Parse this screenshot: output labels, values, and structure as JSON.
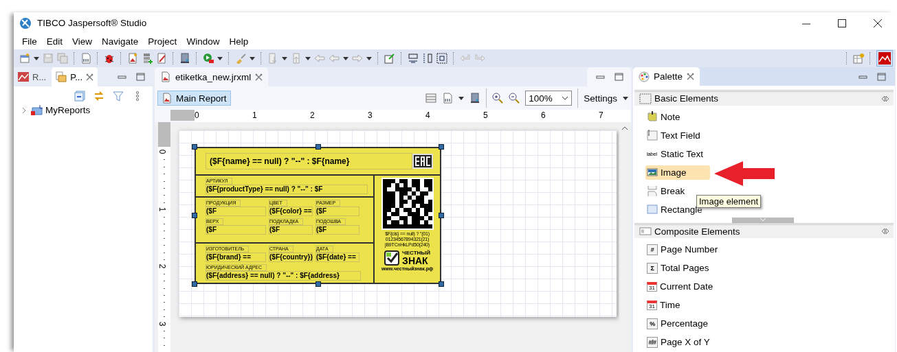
{
  "window": {
    "title": "TIBCO Jaspersoft® Studio"
  },
  "menu": [
    "File",
    "Edit",
    "View",
    "Navigate",
    "Project",
    "Window",
    "Help"
  ],
  "left_panel": {
    "tabs": [
      {
        "label": "R...",
        "selected": false
      },
      {
        "label": "P...",
        "selected": true
      }
    ],
    "tree": [
      {
        "label": "MyReports",
        "expanded": false
      }
    ]
  },
  "editor": {
    "tab": "etiketka_new.jrxml",
    "main_report": {
      "label": "Main Report",
      "selected": true
    },
    "zoom": "100%",
    "settings": "Settings",
    "ruler_h": [
      "0",
      "1",
      "2",
      "3",
      "4",
      "5",
      "6",
      "7"
    ],
    "ruler_v": [
      "0",
      "1",
      "2",
      "3"
    ],
    "label": {
      "title": "($F{name} == null) ? \"--\" :  $F{name}",
      "article": {
        "caption": "АРТИКУЛ",
        "value": "($F{productType} == null) ? \"--\" :  $F"
      },
      "product_fields": [
        {
          "caption": "ПРОДУКЦИЯ",
          "value": "($F"
        },
        {
          "caption": "ЦВЕТ",
          "value": "($F{color} =="
        },
        {
          "caption": "РАЗМЕР",
          "value": "($F"
        },
        {
          "caption": "ВЕРХ",
          "value": "($F"
        },
        {
          "caption": "ПОДКЛАДКА",
          "value": "($F"
        },
        {
          "caption": "ПОДОШВА",
          "value": "($F"
        }
      ],
      "maker_fields": [
        {
          "caption": "ИЗГОТОВИТЕЛЬ",
          "value": "($F{brand} =="
        },
        {
          "caption": "СТРАНА",
          "value": "($F{country})"
        },
        {
          "caption": "ДАТА",
          "value": "($F{date} =="
        }
      ],
      "address": {
        "caption": "ЮРИДИЧЕСКИЙ АДРЕС",
        "value": "($F{address} == null) ? \"--\" :  $F{address}"
      },
      "code_lines": [
        "$F{cis} == null) ? \"(01)",
        "01234567894321(21)",
        "jB9TCnHkLPd50(240)"
      ],
      "brand": [
        "ЧЕСТНЫЙ",
        "ЗНАК"
      ],
      "url": "www.честныйзнак.рф"
    }
  },
  "palette": {
    "tab": "Palette",
    "groups": [
      {
        "title": "Basic Elements",
        "items": [
          {
            "label": "Note",
            "kind": "note",
            "selected": false
          },
          {
            "label": "Text Field",
            "kind": "text-field",
            "selected": false
          },
          {
            "label": "Static Text",
            "kind": "static-text",
            "glyph": "label",
            "selected": false
          },
          {
            "label": "Image",
            "kind": "image",
            "selected": true
          },
          {
            "label": "Break",
            "kind": "break",
            "selected": false
          },
          {
            "label": "Rectangle",
            "kind": "rectangle",
            "selected": false
          }
        ]
      },
      {
        "title": "Composite Elements",
        "items": [
          {
            "label": "Page Number",
            "kind": "glyph",
            "glyph": "#",
            "selected": false
          },
          {
            "label": "Total Pages",
            "kind": "glyph",
            "glyph": "Σ",
            "selected": false
          },
          {
            "label": "Current Date",
            "kind": "calendar",
            "glyph": "31",
            "selected": false
          },
          {
            "label": "Time",
            "kind": "calendar",
            "glyph": "31",
            "selected": false
          },
          {
            "label": "Percentage",
            "kind": "glyph",
            "glyph": "%",
            "selected": false
          },
          {
            "label": "Page X of Y",
            "kind": "glyph",
            "glyph": "#/#",
            "selected": false
          }
        ]
      }
    ],
    "tooltip": "Image element"
  }
}
